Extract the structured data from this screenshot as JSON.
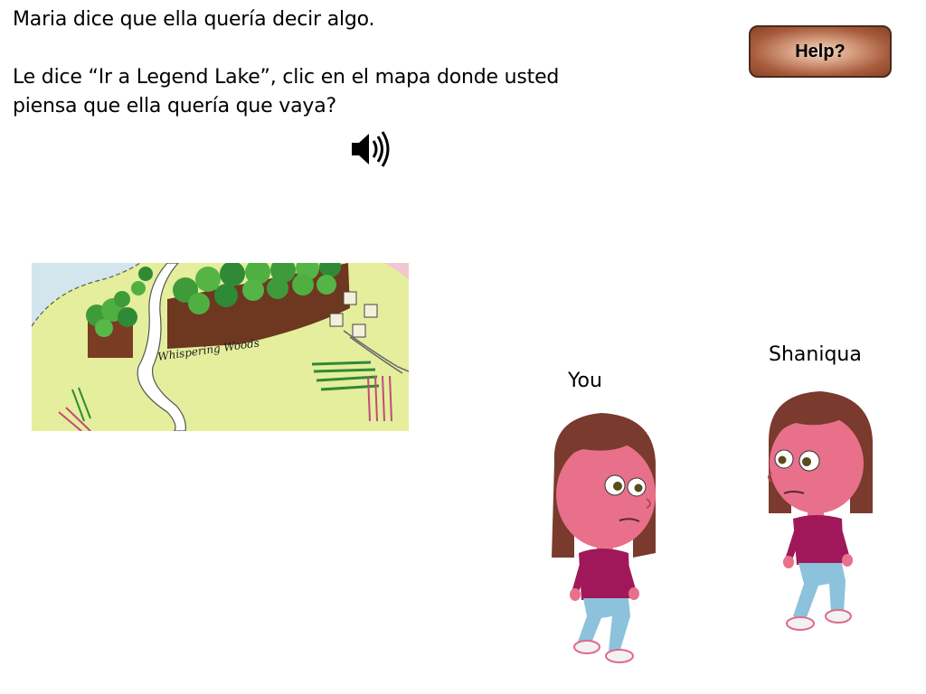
{
  "instructions": {
    "line1": "Maria dice que ella quería decir algo.",
    "line2": "Le dice “Ir a Legend Lake”, clic en el mapa donde usted",
    "line3": "piensa que ella quería que vaya?"
  },
  "help_button": {
    "label": "Help?",
    "colors": {
      "center": "#f4d9c8",
      "edge": "#8a4428",
      "border": "#4a2a1a"
    }
  },
  "audio": {
    "icon": "speaker-icon"
  },
  "map": {
    "label": "Whispering Woods",
    "colors": {
      "grass": "#e6f0a0",
      "water": "#cde4ee",
      "trees": "#3f9a3a",
      "trunks": "#6b3a22"
    }
  },
  "characters": [
    {
      "label": "You",
      "skin": "#e8708a",
      "hair": "#7a3a2e",
      "shirt": "#a0185a",
      "pants": "#8cc2dc"
    },
    {
      "label": "Shaniqua",
      "skin": "#e8708a",
      "hair": "#7a3a2e",
      "shirt": "#a0185a",
      "pants": "#8cc2dc"
    }
  ]
}
